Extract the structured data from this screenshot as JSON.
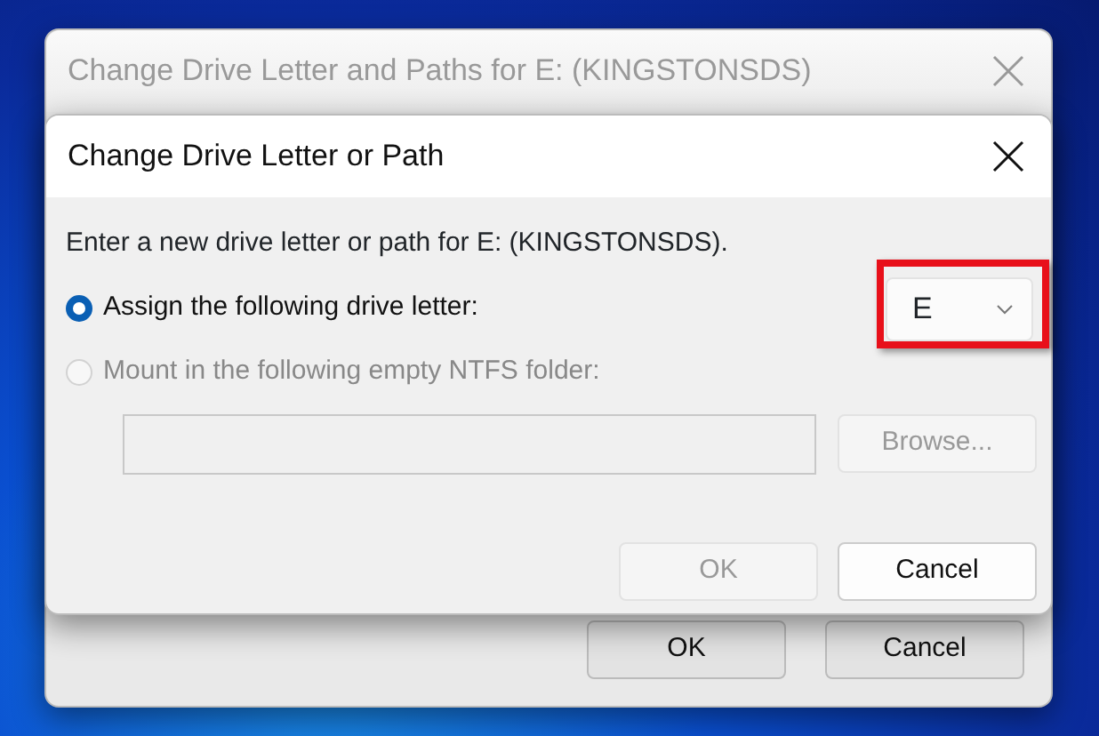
{
  "back_window": {
    "title": "Change Drive Letter and Paths for E: (KINGSTONSDS)",
    "active": false,
    "buttons": [
      {
        "label": "OK"
      },
      {
        "label": "Cancel"
      }
    ]
  },
  "dialog": {
    "title": "Change Drive Letter or Path",
    "active": true,
    "instruction": "Enter a new drive letter or path for E: (KINGSTONSDS).",
    "options": [
      {
        "label": "Assign the following drive letter:",
        "selected": true,
        "disabled": false,
        "kind": "letter"
      },
      {
        "label": "Mount in the following empty NTFS folder:",
        "selected": false,
        "disabled": true,
        "kind": "folder"
      }
    ],
    "drive_letter": {
      "value": "E",
      "highlighted": true
    },
    "folder_field": {
      "disabled": true
    },
    "browse_button": {
      "label": "Browse...",
      "disabled": true
    },
    "buttons": [
      {
        "label": "OK",
        "disabled": true
      },
      {
        "label": "Cancel",
        "disabled": false
      }
    ]
  }
}
